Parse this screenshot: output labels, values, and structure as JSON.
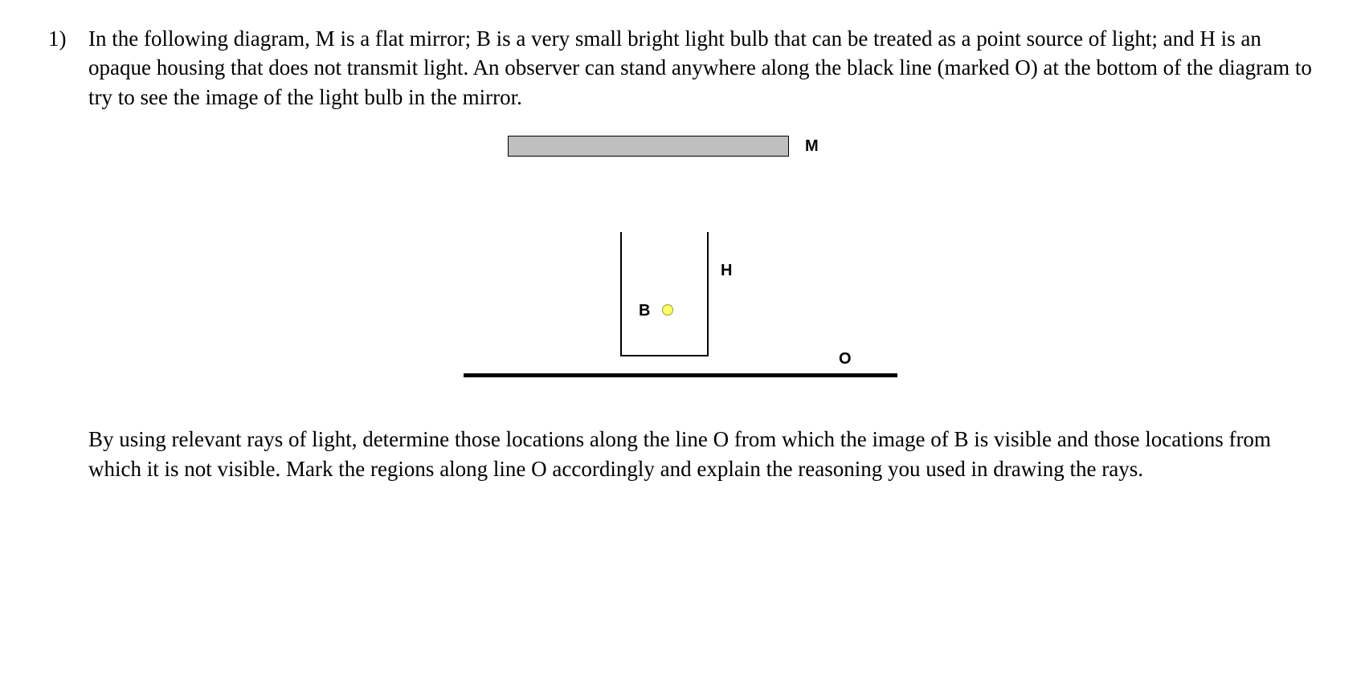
{
  "problem": {
    "number": "1)",
    "paragraph1": "In the following diagram, M is a flat mirror; B is a very small bright light bulb that can be treated as a point source of light; and H is an opaque housing that does not transmit light. An observer can stand anywhere along the black line (marked O) at the bottom of the diagram to try to see the image of the light bulb in the mirror.",
    "paragraph2": "By using relevant rays of light, determine those locations along the line O from which the image of B is visible and those locations from which it is not visible. Mark the regions along line O accordingly and explain the reasoning you used in drawing the rays."
  },
  "diagram": {
    "mirror_label": "M",
    "housing_label": "H",
    "bulb_label": "B",
    "observer_label": "O"
  }
}
